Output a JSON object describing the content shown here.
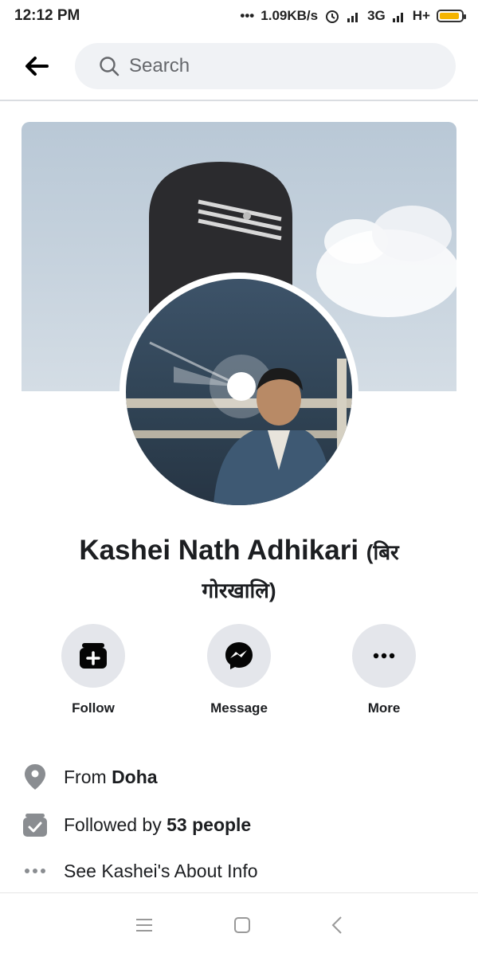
{
  "status_bar": {
    "time": "12:12 PM",
    "network_speed": "1.09KB/s",
    "network1": "3G",
    "network2": "H+",
    "icons": [
      "dots-icon",
      "alarm-icon",
      "signal-icon",
      "signal-icon",
      "battery-icon"
    ]
  },
  "top_bar": {
    "back_icon": "back-arrow-icon",
    "search_placeholder": "Search"
  },
  "profile": {
    "name": "Kashei Nath Adhikari",
    "nickname_line1": "(बिर",
    "nickname_line2": "गोरखालि)"
  },
  "actions": [
    {
      "label": "Follow",
      "icon": "follow-icon"
    },
    {
      "label": "Message",
      "icon": "messenger-icon"
    },
    {
      "label": "More",
      "icon": "more-dots-icon"
    }
  ],
  "info": {
    "from_prefix": "From",
    "from_value": "Doha",
    "followed_prefix": "Followed by",
    "followed_value": "53 people",
    "about": "See Kashei's About Info"
  },
  "colors": {
    "search_bg": "#f0f2f5",
    "button_bg": "#e4e6eb",
    "text": "#1c1e21",
    "battery": "#f5b400"
  }
}
